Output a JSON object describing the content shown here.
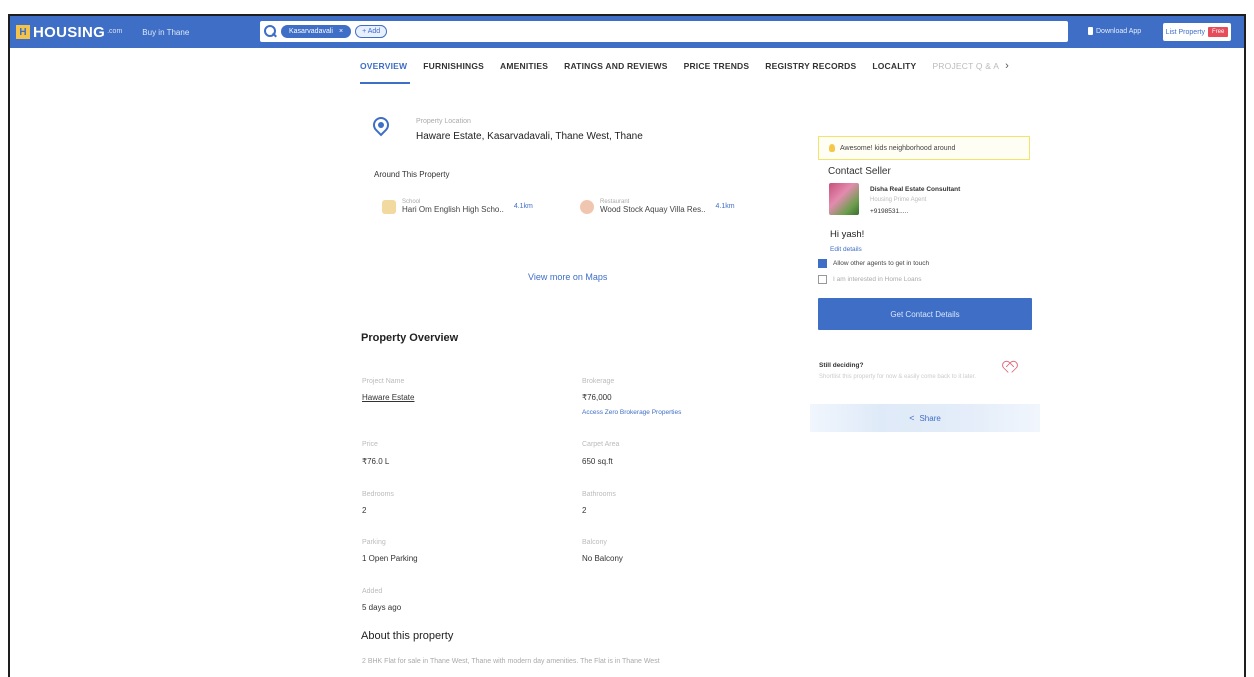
{
  "header": {
    "logo": "HOUSING",
    "logo_sub": ".com",
    "city": "Buy in Thane",
    "search_chip": "Kasarvadavali",
    "search_chip_close": "×",
    "add_chip": "+ Add",
    "download_app": "Download App",
    "list_property": "List Property",
    "free_badge": "Free"
  },
  "tabs": [
    {
      "label": "OVERVIEW",
      "active": true
    },
    {
      "label": "FURNISHINGS"
    },
    {
      "label": "AMENITIES"
    },
    {
      "label": "RATINGS AND REVIEWS"
    },
    {
      "label": "PRICE TRENDS"
    },
    {
      "label": "REGISTRY RECORDS"
    },
    {
      "label": "LOCALITY"
    },
    {
      "label": "PROJECT Q & A"
    }
  ],
  "tabs_next": "›",
  "location": {
    "label": "Property Location",
    "value": "Haware Estate, Kasarvadavali, Thane West, Thane"
  },
  "around": {
    "title": "Around This Property",
    "pois": [
      {
        "category": "School",
        "name": "Hari Om English High Scho..",
        "distance": "4.1km"
      },
      {
        "category": "Restaurant",
        "name": "Wood Stock Aquay Villa Res..",
        "distance": "4.1km"
      }
    ]
  },
  "view_maps": "View more on Maps",
  "overview": {
    "title": "Property Overview",
    "fields": {
      "project_name_label": "Project Name",
      "project_name_value": "Haware Estate",
      "brokerage_label": "Brokerage",
      "brokerage_value": "₹76,000",
      "zero_brokerage": "Access Zero Brokerage Properties",
      "price_label": "Price",
      "price_value": "₹76.0 L",
      "carpet_label": "Carpet Area",
      "carpet_value": "650 sq.ft",
      "bedrooms_label": "Bedrooms",
      "bedrooms_value": "2",
      "bathrooms_label": "Bathrooms",
      "bathrooms_value": "2",
      "parking_label": "Parking",
      "parking_value": "1 Open Parking",
      "balcony_label": "Balcony",
      "balcony_value": "No Balcony",
      "added_label": "Added",
      "added_value": "5 days ago"
    }
  },
  "about": {
    "title": "About this property",
    "text": "2 BHK Flat for sale in Thane West, Thane with modern day amenities. The Flat is in Thane West"
  },
  "sidebar": {
    "banner": "Awesome! kids neighborhood around",
    "contact_title": "Contact Seller",
    "seller_name": "Disha Real Estate Consultant",
    "seller_sub": "Housing Prime Agent",
    "seller_phone": "+9198531.....",
    "greeting": "Hi yash!",
    "edit_details": "Edit details",
    "check_agents": "Allow other agents to get in touch",
    "check_loans": "I am interested in Home Loans",
    "get_contact": "Get Contact Details",
    "still_title": "Still deciding?",
    "still_sub": "Shortlist this property for now & easily come back to it later.",
    "share": "Share"
  }
}
